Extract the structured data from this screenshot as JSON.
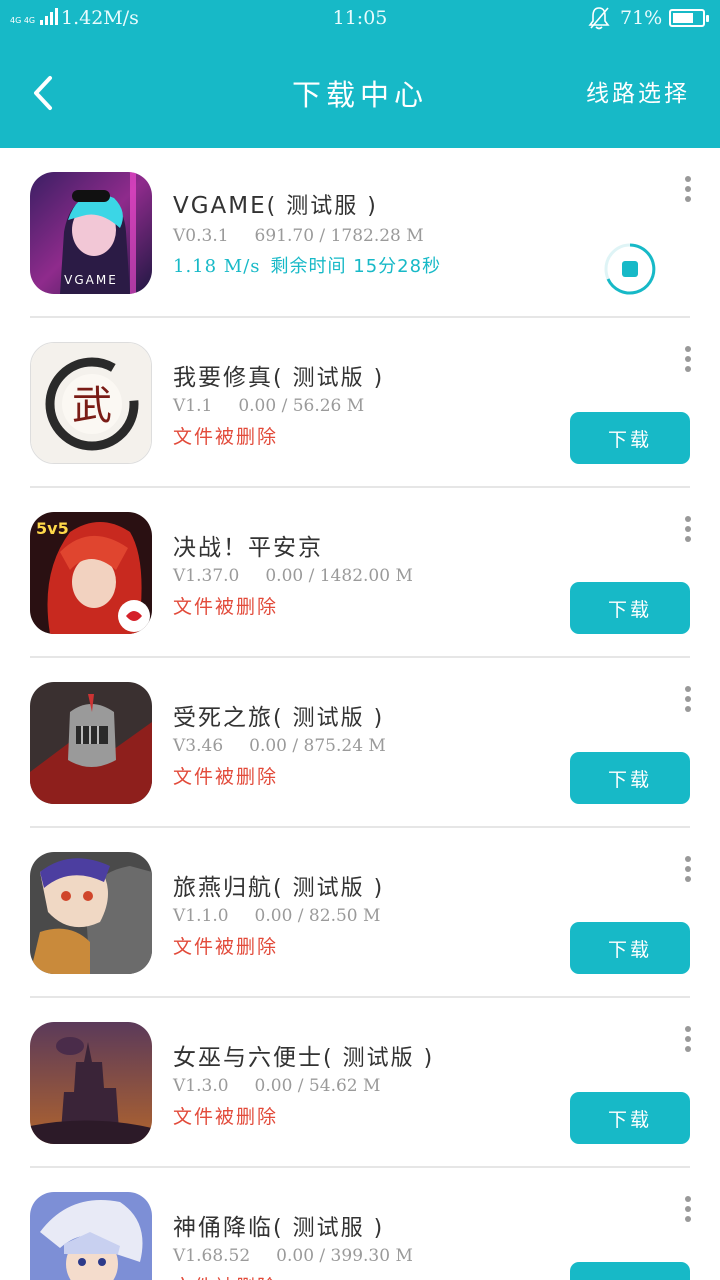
{
  "status_bar": {
    "network": "4G 4G",
    "speed": "1.42M/s",
    "time": "11:05",
    "battery": "71%",
    "battery_level": 0.71
  },
  "header": {
    "title": "下载中心",
    "route_label": "线路选择",
    "back_icon": "back-arrow-icon"
  },
  "colors": {
    "accent": "#17b9c7",
    "deleted": "#e24b3b",
    "meta": "#9a9a9a"
  },
  "downloads": [
    {
      "name": "VGAME",
      "tag": "( 测试服 )",
      "icon_text": "VGAME",
      "version": "V0.3.1",
      "size": "691.70 / 1782.28 M",
      "speed": "1.18 M/s",
      "remaining": "剩余时间 15分28秒",
      "state": "downloading"
    },
    {
      "name": "我要修真",
      "tag": "( 测试版 )",
      "icon_text": "武",
      "version": "V1.1",
      "size": "0.00 / 56.26 M",
      "status": "文件被删除",
      "button": "下载"
    },
    {
      "name": "决战！平安京",
      "tag": "",
      "icon_text": "5v5",
      "version": "V1.37.0",
      "size": "0.00 / 1482.00 M",
      "status": "文件被删除",
      "button": "下载"
    },
    {
      "name": "受死之旅",
      "tag": "( 测试版 )",
      "version": "V3.46",
      "size": "0.00 / 875.24 M",
      "status": "文件被删除",
      "button": "下载"
    },
    {
      "name": "旅燕归航",
      "tag": "( 测试版 )",
      "version": "V1.1.0",
      "size": "0.00 / 82.50 M",
      "status": "文件被删除",
      "button": "下载"
    },
    {
      "name": "女巫与六便士",
      "tag": "( 测试版 )",
      "version": "V1.3.0",
      "size": "0.00 / 54.62 M",
      "status": "文件被删除",
      "button": "下载"
    },
    {
      "name": "神俑降临",
      "tag": "( 测试服 )",
      "version": "V1.68.52",
      "size": "0.00 / 399.30 M",
      "status": "文件被删除",
      "button": "下载"
    }
  ]
}
